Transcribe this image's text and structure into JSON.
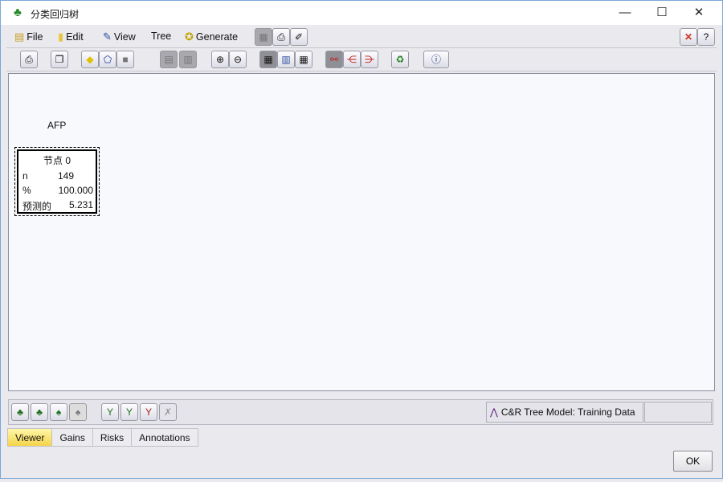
{
  "window": {
    "title": "分类回归树",
    "icon": "tree-icon"
  },
  "menu": [
    {
      "label": "File",
      "icon": "file-icon"
    },
    {
      "label": "Edit",
      "icon": "clipboard-icon"
    },
    {
      "label": "View",
      "icon": "flashlight-icon"
    },
    {
      "label": "Tree",
      "icon": ""
    },
    {
      "label": "Generate",
      "icon": "generate-icon"
    }
  ],
  "tree": {
    "target": "AFP",
    "node": {
      "title": "节点 0",
      "rows": [
        {
          "label": "n",
          "value": "149"
        },
        {
          "label": "%",
          "value": "100.000"
        },
        {
          "label": "预测的",
          "value": "5.231"
        }
      ]
    }
  },
  "status": {
    "text": "C&R Tree Model: Training Data"
  },
  "tabs": [
    {
      "label": "Viewer",
      "active": true
    },
    {
      "label": "Gains"
    },
    {
      "label": "Risks"
    },
    {
      "label": "Annotations"
    }
  ],
  "buttons": {
    "ok": "OK"
  },
  "colors": {
    "active_tab": "#f6d44a",
    "close_red": "#d03020"
  }
}
